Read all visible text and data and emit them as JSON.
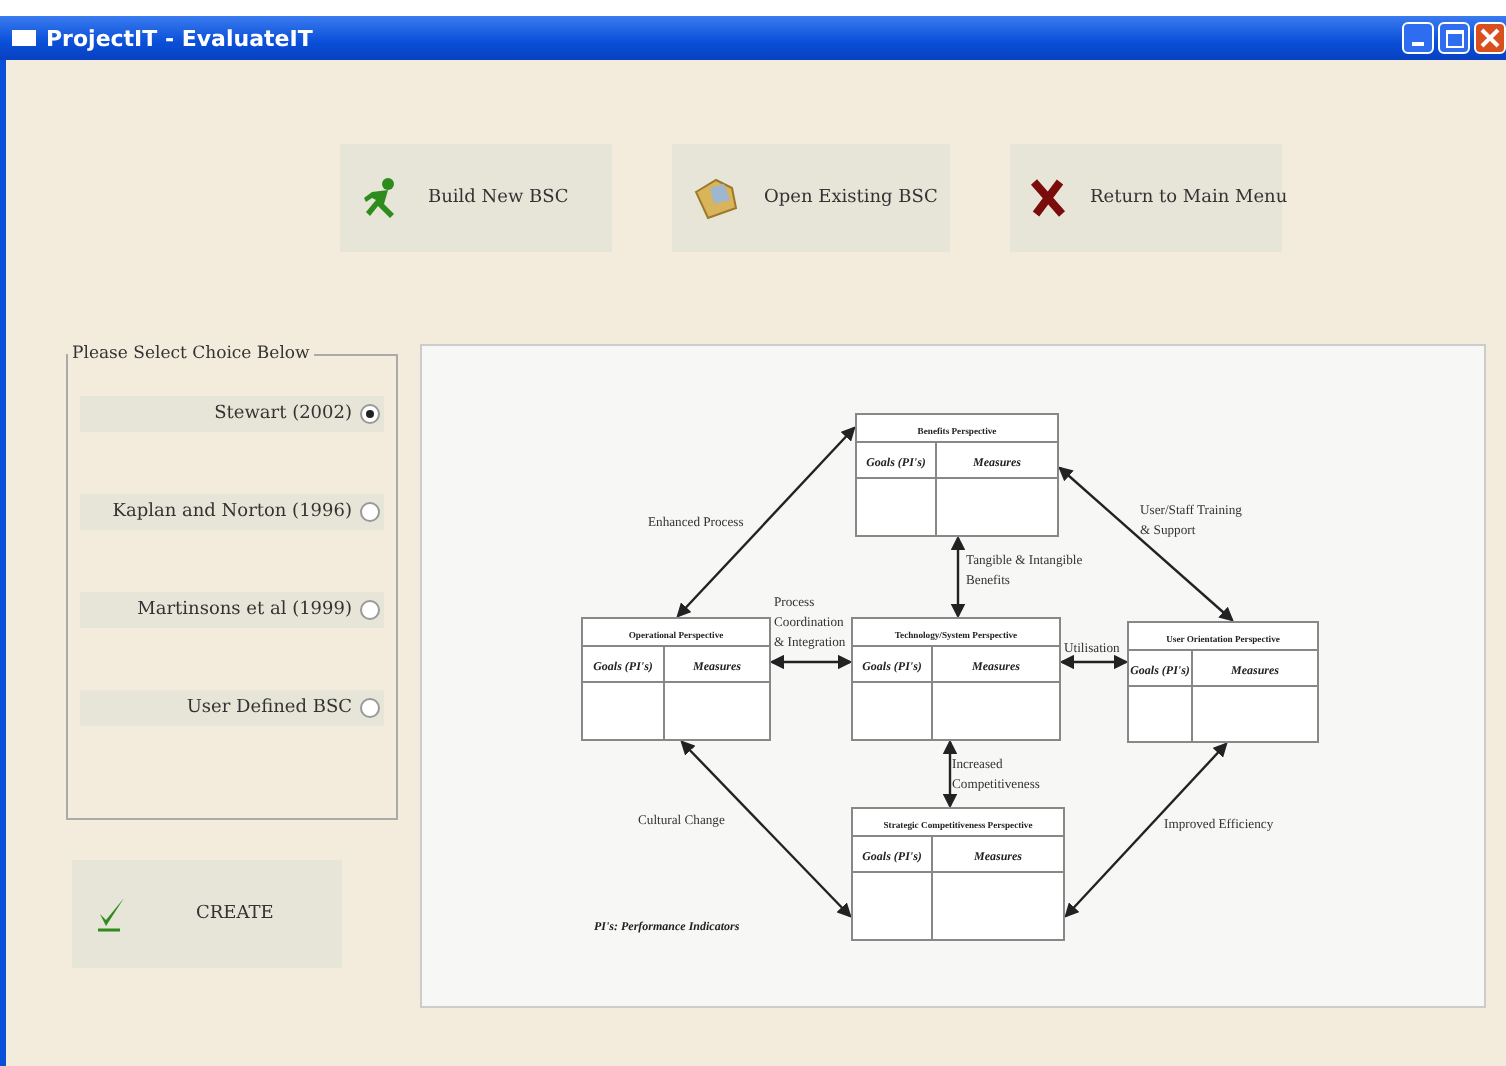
{
  "window": {
    "title": "ProjectIT - EvaluateIT"
  },
  "toolbar": [
    {
      "label": "Build New BSC",
      "kind": "run"
    },
    {
      "label": "Open Existing BSC",
      "kind": "open"
    },
    {
      "label": "Return to Main Menu",
      "kind": "cross"
    }
  ],
  "choices": {
    "legend": "Please Select Choice Below",
    "options": [
      {
        "label": "Stewart (2002)",
        "selected": true
      },
      {
        "label": "Kaplan and Norton (1996)",
        "selected": false
      },
      {
        "label": "Martinsons et al  (1999)",
        "selected": false
      },
      {
        "label": "User Defined BSC",
        "selected": false
      }
    ]
  },
  "create_button": {
    "label": "CREATE"
  },
  "diagram": {
    "perspectives": [
      {
        "title": "Benefits Perspective",
        "goals": "Goals (PI's)",
        "measures": "Measures"
      },
      {
        "title": "Operational  Perspective",
        "goals": "Goals (PI's)",
        "measures": "Measures"
      },
      {
        "title": "Technology/System Perspective",
        "goals": "Goals (PI's)",
        "measures": "Measures"
      },
      {
        "title": "User Orientation Perspective",
        "goals": "Goals (PI's)",
        "measures": "Measures"
      },
      {
        "title": "Strategic Competitiveness  Perspective",
        "goals": "Goals (PI's)",
        "measures": "Measures"
      }
    ],
    "links": [
      [
        "Enhanced Process"
      ],
      [
        "Tangible & Intangible",
        "Benefits"
      ],
      [
        "Process",
        "Coordination",
        "& Integration"
      ],
      [
        "Utilisation"
      ],
      [
        "User/Staff Training",
        "& Support"
      ],
      [
        "Increased",
        "Competitiveness"
      ],
      [
        "Cultural Change"
      ],
      [
        "Improved Efficiency"
      ]
    ],
    "footnote": "PI's: Performance Indicators"
  }
}
